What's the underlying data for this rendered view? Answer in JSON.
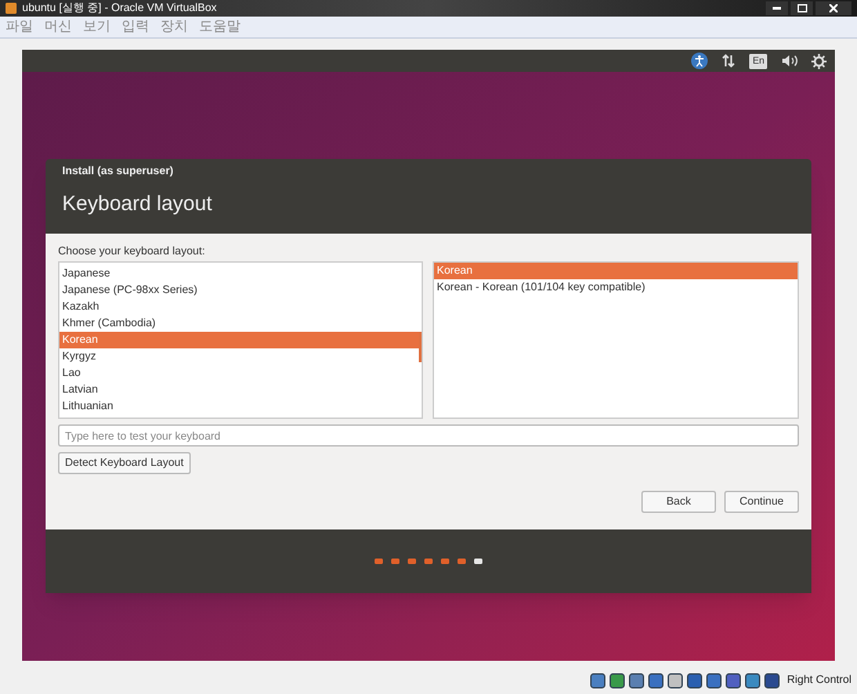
{
  "window": {
    "title": "ubuntu [실행 중] - Oracle VM VirtualBox"
  },
  "menu": [
    "파일",
    "머신",
    "보기",
    "입력",
    "장치",
    "도움말"
  ],
  "top_panel": {
    "indicator": "En"
  },
  "dialog": {
    "caption": "Install (as superuser)",
    "heading": "Keyboard layout",
    "prompt": "Choose your keyboard layout:",
    "layouts": [
      {
        "label": "Japanese",
        "selected": false
      },
      {
        "label": "Japanese (PC-98xx Series)",
        "selected": false
      },
      {
        "label": "Kazakh",
        "selected": false
      },
      {
        "label": "Khmer (Cambodia)",
        "selected": false
      },
      {
        "label": "Korean",
        "selected": true
      },
      {
        "label": "Kyrgyz",
        "selected": false
      },
      {
        "label": "Lao",
        "selected": false
      },
      {
        "label": "Latvian",
        "selected": false
      },
      {
        "label": "Lithuanian",
        "selected": false
      }
    ],
    "variants": [
      {
        "label": "Korean",
        "selected": true
      },
      {
        "label": "Korean - Korean (101/104 key compatible)",
        "selected": false
      }
    ],
    "test_field": {
      "placeholder": "Type here to test your keyboard"
    },
    "detect_button": "Detect Keyboard Layout",
    "buttons": [
      "Back",
      "Continue"
    ],
    "progress": [
      {
        "current": false
      },
      {
        "current": false
      },
      {
        "current": false
      },
      {
        "current": false
      },
      {
        "current": false
      },
      {
        "current": false
      },
      {
        "current": true
      }
    ]
  },
  "status_bar": {
    "host_key": "Right Control"
  }
}
